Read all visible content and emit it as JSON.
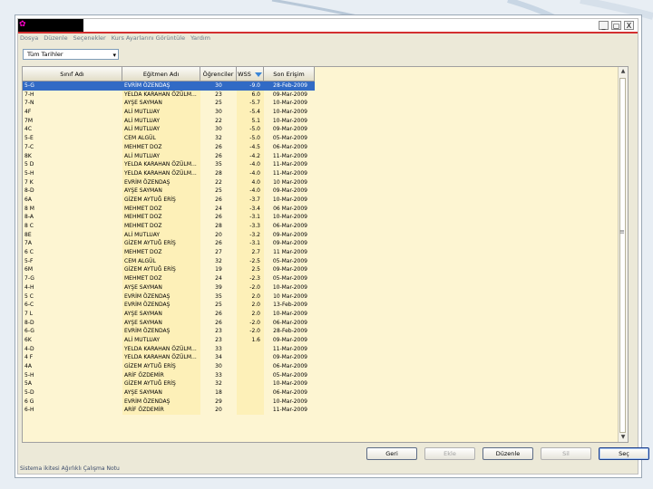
{
  "window": {
    "close_label": "X",
    "restore_label": "▢",
    "minimize_label": "_"
  },
  "menu": [
    "Dosya",
    "Düzenle",
    "Seçenekler",
    "Kurs Ayarlarını Görüntüle",
    "Yardım"
  ],
  "filter": {
    "value": "Tüm Tarihler"
  },
  "columns": [
    "Sınıf Adı",
    "Eğitmen Adı",
    "Öğrenciler",
    "WSS",
    "Son Erişim"
  ],
  "sorted_column_icon": "sort-desc-icon",
  "rows": [
    [
      "5-G",
      "EVRİM ÖZENDAŞ",
      "30",
      "-9.0",
      "28-Feb-2009"
    ],
    [
      "7-H",
      "YELDA KARAHAN ÖZÜLM...",
      "23",
      "6.0",
      "09-Mar-2009"
    ],
    [
      "7-N",
      "AYŞE SAYMAN",
      "25",
      "-5.7",
      "10-Mar-2009"
    ],
    [
      "4F",
      "ALİ MUTLUAY",
      "30",
      "-5.4",
      "10-Mar-2009"
    ],
    [
      "7M",
      "ALİ MUTLUAY",
      "22",
      "5.1",
      "10-Mar-2009"
    ],
    [
      "4C",
      "ALİ MUTLUAY",
      "30",
      "-5.0",
      "09-Mar-2009"
    ],
    [
      "5-E",
      "CEM ALGÜL",
      "32",
      "-5.0",
      "05-Mar-2009"
    ],
    [
      "7-C",
      "MEHMET DOZ",
      "26",
      "-4.5",
      "06-Mar-2009"
    ],
    [
      "8K",
      "ALİ MUTLUAY",
      "26",
      "-4.2",
      "11-Mar-2009"
    ],
    [
      "5 D",
      "YELDA KARAHAN ÖZÜLM...",
      "35",
      "-4.0",
      "11-Mar-2009"
    ],
    [
      "5-H",
      "YELDA KARAHAN ÖZÜLM...",
      "28",
      "-4.0",
      "11-Mar-2009"
    ],
    [
      "7 K",
      "EVRİM ÖZENDAŞ",
      "22",
      "4.0",
      "10 Mar-2009"
    ],
    [
      "8-D",
      "AYŞE SAYMAN",
      "25",
      "-4.0",
      "09-Mar-2009"
    ],
    [
      "6A",
      "GİZEM AYTUĞ ERİŞ",
      "26",
      "-3.7",
      "10-Mar-2009"
    ],
    [
      "8 M",
      "MEHMET DOZ",
      "24",
      "-3.4",
      "06 Mar-2009"
    ],
    [
      "8-A",
      "MEHMET DOZ",
      "26",
      "-3.1",
      "10-Mar-2009"
    ],
    [
      "8 C",
      "MEHMET DOZ",
      "28",
      "-3.3",
      "06-Mar-2009"
    ],
    [
      "8E",
      "ALİ MUTLUAY",
      "20",
      "-3.2",
      "09-Mar-2009"
    ],
    [
      "7A",
      "GİZEM AYTUĞ ERİŞ",
      "26",
      "-3.1",
      "09-Mar-2009"
    ],
    [
      "6 C",
      "MEHMET DOZ",
      "27",
      "2.7",
      "11 Mar-2009"
    ],
    [
      "5-F",
      "CEM ALGÜL",
      "32",
      "-2.5",
      "05-Mar-2009"
    ],
    [
      "6M",
      "GİZEM AYTUĞ ERİŞ",
      "19",
      "2.5",
      "09-Mar-2009"
    ],
    [
      "7-G",
      "MEHMET DOZ",
      "24",
      "-2.3",
      "05-Mar-2009"
    ],
    [
      "4-H",
      "AYŞE SAYMAN",
      "39",
      "-2.0",
      "10-Mar-2009"
    ],
    [
      "5 C",
      "EVRİM ÖZENDAŞ",
      "35",
      "2.0",
      "10 Mar-2009"
    ],
    [
      "6-C",
      "EVRİM ÖZENDAŞ",
      "25",
      "2.0",
      "13-Feb-2009"
    ],
    [
      "7 L",
      "AYŞE SAYMAN",
      "26",
      "2.0",
      "10-Mar-2009"
    ],
    [
      "8-D",
      "AYŞE SAYMAN",
      "26",
      "-2.0",
      "06-Mar-2009"
    ],
    [
      "6-G",
      "EVRİM ÖZENDAŞ",
      "23",
      "-2.0",
      "28-Feb-2009"
    ],
    [
      "6K",
      "ALİ MUTLUAY",
      "23",
      "1.6",
      "09-Mar-2009"
    ],
    [
      "4-D",
      "YELDA KARAHAN ÖZÜLM...",
      "33",
      "",
      "11-Mar-2009"
    ],
    [
      "4 F",
      "YELDA KARAHAN ÖZÜLM...",
      "34",
      "",
      "09-Mar-2009"
    ],
    [
      "4A",
      "GİZEM AYTUĞ ERİŞ",
      "30",
      "",
      "06-Mar-2009"
    ],
    [
      "5-H",
      "ARİF ÖZDEMİR",
      "33",
      "",
      "05-Mar-2009"
    ],
    [
      "5A",
      "GİZEM AYTUĞ ERİŞ",
      "32",
      "",
      "10-Mar-2009"
    ],
    [
      "5-D",
      "AYŞE SAYMAN",
      "18",
      "",
      "06-Mar-2009"
    ],
    [
      "6 G",
      "EVRİM ÖZENDAŞ",
      "29",
      "",
      "10-Mar-2009"
    ],
    [
      "6-H",
      "ARİF ÖZDEMİR",
      "20",
      "",
      "11-Mar-2009"
    ]
  ],
  "selected_row": 0,
  "buttons": {
    "back": "Geri",
    "add": "Ekle",
    "edit": "Düzenle",
    "delete": "Sil",
    "select": "Seç"
  },
  "status": "Sistema ikitesi Ağırlıklı Çalışma Notu"
}
